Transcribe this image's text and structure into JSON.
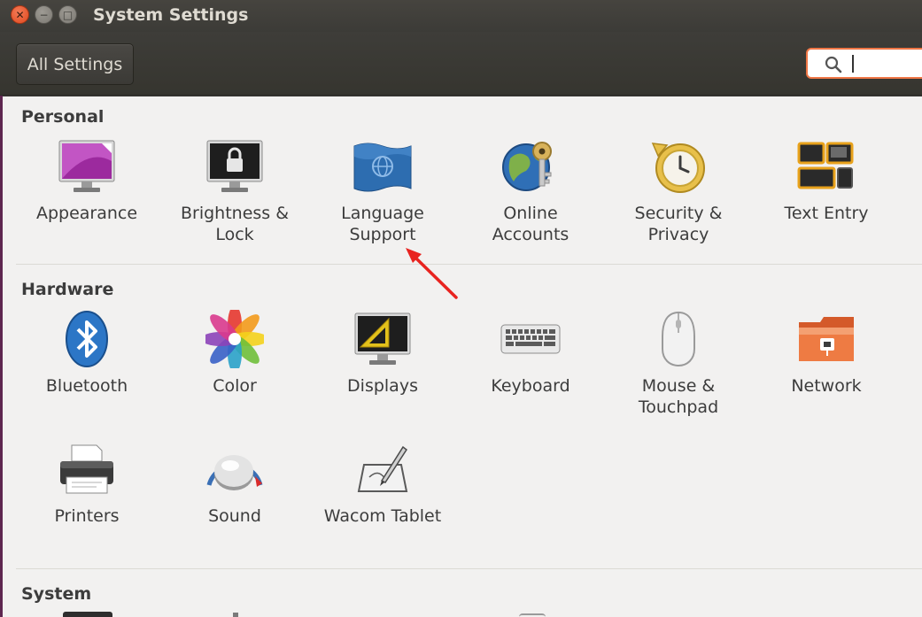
{
  "window": {
    "title": "System Settings"
  },
  "toolbar": {
    "all_settings_label": "All Settings",
    "search_value": ""
  },
  "sections": [
    {
      "title": "Personal",
      "items": [
        {
          "label": "Appearance",
          "icon": "appearance-icon"
        },
        {
          "label": "Brightness &\nLock",
          "icon": "brightness-lock-icon"
        },
        {
          "label": "Language\nSupport",
          "icon": "language-support-icon"
        },
        {
          "label": "Online\nAccounts",
          "icon": "online-accounts-icon"
        },
        {
          "label": "Security &\nPrivacy",
          "icon": "security-privacy-icon"
        },
        {
          "label": "Text Entry",
          "icon": "text-entry-icon"
        }
      ]
    },
    {
      "title": "Hardware",
      "items": [
        {
          "label": "Bluetooth",
          "icon": "bluetooth-icon"
        },
        {
          "label": "Color",
          "icon": "color-icon"
        },
        {
          "label": "Displays",
          "icon": "displays-icon"
        },
        {
          "label": "Keyboard",
          "icon": "keyboard-icon"
        },
        {
          "label": "Mouse &\nTouchpad",
          "icon": "mouse-touchpad-icon"
        },
        {
          "label": "Network",
          "icon": "network-icon"
        },
        {
          "label": "Printers",
          "icon": "printers-icon"
        },
        {
          "label": "Sound",
          "icon": "sound-icon"
        },
        {
          "label": "Wacom Tablet",
          "icon": "wacom-tablet-icon"
        }
      ]
    },
    {
      "title": "System",
      "items": []
    }
  ],
  "colors": {
    "accent": "#f07746",
    "titlebar": "#3c3b37",
    "content_bg": "#f2f1f0",
    "annotation_arrow": "#e8231f"
  }
}
